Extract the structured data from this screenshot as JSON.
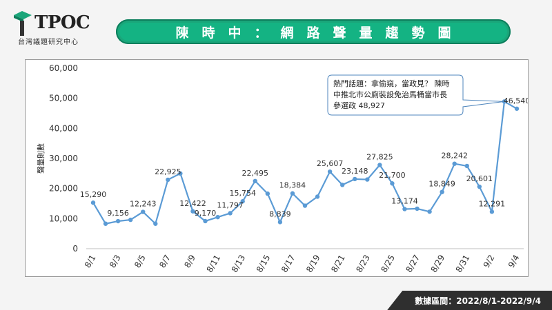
{
  "brand": {
    "name": "TPOC",
    "subtitle": "台灣議題研究中心",
    "colors": {
      "green": "#14b383",
      "dark": "#2f2f2f"
    }
  },
  "header": {
    "title": "陳時中：網路聲量趨勢圖"
  },
  "footer": {
    "label": "數據區間：2022/8/1-2022/9/4"
  },
  "chart_data": {
    "type": "line",
    "ylabel": "聲量則數",
    "ylim": [
      0,
      60000
    ],
    "yticks": [
      0,
      10000,
      20000,
      30000,
      40000,
      50000,
      60000
    ],
    "ytick_labels": [
      "0",
      "10,000",
      "20,000",
      "30,000",
      "40,000",
      "50,000",
      "60,000"
    ],
    "grid": false,
    "line_color": "#5b9bd5",
    "x": [
      "8/1",
      "8/2",
      "8/3",
      "8/4",
      "8/5",
      "8/6",
      "8/7",
      "8/8",
      "8/9",
      "8/10",
      "8/11",
      "8/12",
      "8/13",
      "8/14",
      "8/15",
      "8/16",
      "8/17",
      "8/18",
      "8/19",
      "8/20",
      "8/21",
      "8/22",
      "8/23",
      "8/24",
      "8/25",
      "8/26",
      "8/27",
      "8/28",
      "8/29",
      "8/30",
      "8/31",
      "9/1",
      "9/2",
      "9/3",
      "9/4"
    ],
    "xtick_labels": [
      "8/1",
      "8/3",
      "8/5",
      "8/7",
      "8/9",
      "8/11",
      "8/13",
      "8/15",
      "8/17",
      "8/19",
      "8/21",
      "8/23",
      "8/25",
      "8/27",
      "8/29",
      "8/31",
      "9/2",
      "9/4"
    ],
    "values": [
      15290,
      8300,
      9156,
      9600,
      12243,
      8300,
      22925,
      25000,
      12422,
      9170,
      10500,
      11797,
      15754,
      22495,
      18300,
      8839,
      18384,
      14300,
      17300,
      25607,
      21200,
      23148,
      23000,
      27825,
      21700,
      13174,
      13300,
      12300,
      18849,
      28242,
      27500,
      20601,
      12291,
      48927,
      46540
    ],
    "data_labels": [
      {
        "x": "8/1",
        "text": "15,290"
      },
      {
        "x": "8/3",
        "text": "9,156"
      },
      {
        "x": "8/5",
        "text": "12,243"
      },
      {
        "x": "8/7",
        "text": "22,925"
      },
      {
        "x": "8/9",
        "text": "12,422"
      },
      {
        "x": "8/10",
        "text": "9,170"
      },
      {
        "x": "8/12",
        "text": "11,797"
      },
      {
        "x": "8/13",
        "text": "15,754"
      },
      {
        "x": "8/14",
        "text": "22,495"
      },
      {
        "x": "8/16",
        "text": "8,839"
      },
      {
        "x": "8/17",
        "text": "18,384"
      },
      {
        "x": "8/20",
        "text": "25,607"
      },
      {
        "x": "8/22",
        "text": "23,148"
      },
      {
        "x": "8/24",
        "text": "27,825"
      },
      {
        "x": "8/25",
        "text": "21,700"
      },
      {
        "x": "8/26",
        "text": "13,174"
      },
      {
        "x": "8/29",
        "text": "18,849"
      },
      {
        "x": "8/30",
        "text": "28,242"
      },
      {
        "x": "9/1",
        "text": "20,601"
      },
      {
        "x": "9/2",
        "text": "12,291"
      },
      {
        "x": "9/4",
        "text": "46,540"
      }
    ],
    "annotation": {
      "x": "9/3",
      "lines": [
        "熱門話題：拿偷窺，當政見？ 陳時",
        "中推北市公廁裝設免治馬桶當市長",
        "參選政 48,927"
      ]
    }
  }
}
